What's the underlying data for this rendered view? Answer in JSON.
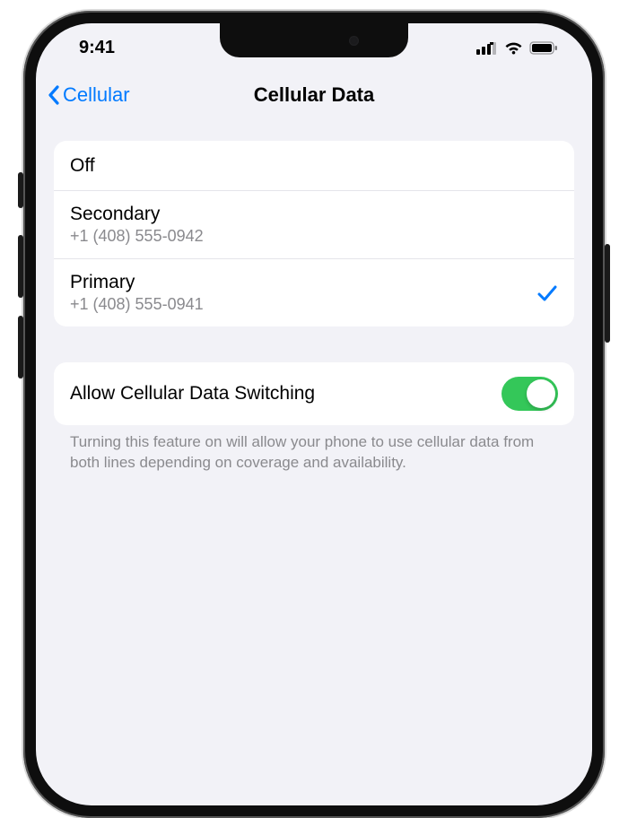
{
  "status": {
    "time": "9:41"
  },
  "nav": {
    "back_label": "Cellular",
    "title": "Cellular Data"
  },
  "options": {
    "off_label": "Off",
    "secondary": {
      "label": "Secondary",
      "number": "+1 (408) 555-0942"
    },
    "primary": {
      "label": "Primary",
      "number": "+1 (408) 555-0941"
    }
  },
  "switching": {
    "label": "Allow Cellular Data Switching",
    "footer": "Turning this feature on will allow your phone to use cellular data from both lines depending on coverage and availability."
  }
}
